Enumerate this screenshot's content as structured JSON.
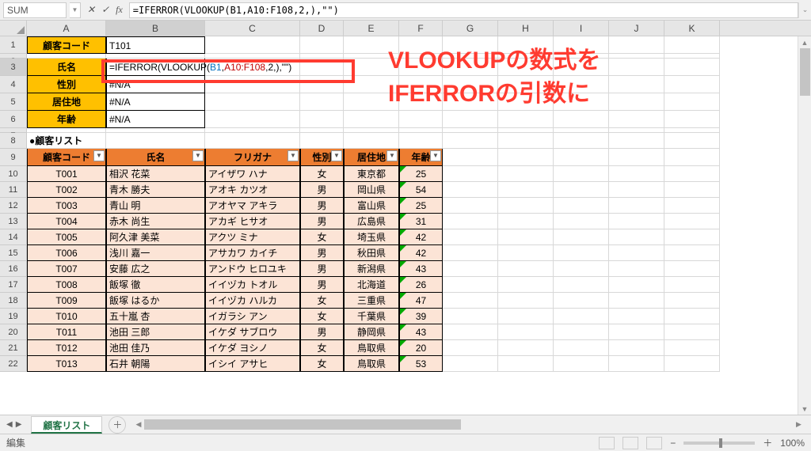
{
  "name_box": "SUM",
  "fb_icons": {
    "cancel": "✕",
    "confirm": "✓",
    "fx": "fx"
  },
  "formula_bar_text": "=IFERROR(VLOOKUP(B1,A10:F108,2,),\"\")",
  "cols": [
    "A",
    "B",
    "C",
    "D",
    "E",
    "F",
    "G",
    "H",
    "I",
    "J",
    "K"
  ],
  "top_block": {
    "r1": {
      "label": "顧客コード",
      "value": "T101"
    },
    "r3": {
      "label": "氏名",
      "formula_pre": "=IFERROR(VLOOKUP(",
      "formula_arg1": "B1",
      "formula_c1": ",",
      "formula_arg2": "A10:F108",
      "formula_post": ",2,),\"\")"
    },
    "r4": {
      "label": "性別",
      "value": "#N/A"
    },
    "r5": {
      "label": "居住地",
      "value": "#N/A"
    },
    "r6": {
      "label": "年齢",
      "value": "#N/A"
    }
  },
  "list_title": "●顧客リスト",
  "headers": [
    "顧客コード",
    "氏名",
    "フリガナ",
    "性別",
    "居住地",
    "年齢"
  ],
  "rows": [
    {
      "code": "T001",
      "name": "相沢 花菜",
      "kana": "アイザワ ハナ",
      "sex": "女",
      "pref": "東京都",
      "age": "25"
    },
    {
      "code": "T002",
      "name": "青木 勝夫",
      "kana": "アオキ カツオ",
      "sex": "男",
      "pref": "岡山県",
      "age": "54"
    },
    {
      "code": "T003",
      "name": "青山 明",
      "kana": "アオヤマ アキラ",
      "sex": "男",
      "pref": "富山県",
      "age": "25"
    },
    {
      "code": "T004",
      "name": "赤木 尚生",
      "kana": "アカギ ヒサオ",
      "sex": "男",
      "pref": "広島県",
      "age": "31"
    },
    {
      "code": "T005",
      "name": "阿久津 美菜",
      "kana": "アクツ ミナ",
      "sex": "女",
      "pref": "埼玉県",
      "age": "42"
    },
    {
      "code": "T006",
      "name": "浅川 嘉一",
      "kana": "アサカワ カイチ",
      "sex": "男",
      "pref": "秋田県",
      "age": "42"
    },
    {
      "code": "T007",
      "name": "安藤 広之",
      "kana": "アンドウ ヒロユキ",
      "sex": "男",
      "pref": "新潟県",
      "age": "43"
    },
    {
      "code": "T008",
      "name": "飯塚 徹",
      "kana": "イイヅカ トオル",
      "sex": "男",
      "pref": "北海道",
      "age": "26"
    },
    {
      "code": "T009",
      "name": "飯塚 はるか",
      "kana": "イイヅカ ハルカ",
      "sex": "女",
      "pref": "三重県",
      "age": "47"
    },
    {
      "code": "T010",
      "name": "五十嵐 杏",
      "kana": "イガラシ アン",
      "sex": "女",
      "pref": "千葉県",
      "age": "39"
    },
    {
      "code": "T011",
      "name": "池田 三郎",
      "kana": "イケダ サブロウ",
      "sex": "男",
      "pref": "静岡県",
      "age": "43"
    },
    {
      "code": "T012",
      "name": "池田 佳乃",
      "kana": "イケダ ヨシノ",
      "sex": "女",
      "pref": "鳥取県",
      "age": "20"
    },
    {
      "code": "T013",
      "name": "石井 朝陽",
      "kana": "イシイ アサヒ",
      "sex": "女",
      "pref": "鳥取県",
      "age": "53"
    }
  ],
  "annotation": {
    "line1": "VLOOKUPの数式を",
    "line2": "IFERRORの引数に"
  },
  "tab_name": "顧客リスト",
  "status": "編集",
  "zoom": "100%"
}
